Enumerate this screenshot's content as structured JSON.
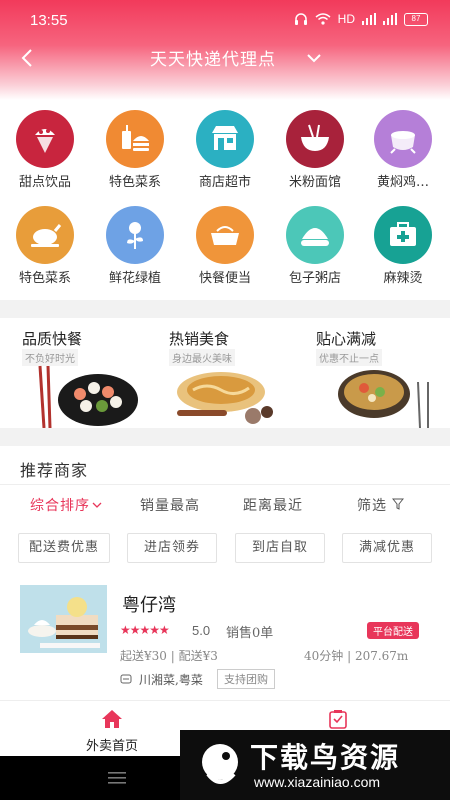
{
  "status_bar": {
    "time": "13:55",
    "network": "HD",
    "battery": "87"
  },
  "navbar": {
    "title": "天天快递代理点"
  },
  "categories": [
    {
      "label": "甜点饮品",
      "icon": "ice-cream-icon",
      "color": "#c8253e"
    },
    {
      "label": "特色菜系",
      "icon": "burger-drink-icon",
      "color": "#f08a33"
    },
    {
      "label": "商店超市",
      "icon": "store-icon",
      "color": "#2bb0c2"
    },
    {
      "label": "米粉面馆",
      "icon": "noodle-bowl-icon",
      "color": "#a8223b"
    },
    {
      "label": "黄焖鸡…",
      "icon": "pot-icon",
      "color": "#b57fd8"
    },
    {
      "label": "特色菜系",
      "icon": "roast-chicken-icon",
      "color": "#e89d3a"
    },
    {
      "label": "鲜花绿植",
      "icon": "flower-icon",
      "color": "#6ea2e5"
    },
    {
      "label": "快餐便当",
      "icon": "bento-icon",
      "color": "#f0953a"
    },
    {
      "label": "包子粥店",
      "icon": "bun-icon",
      "color": "#4cc7b8"
    },
    {
      "label": "麻辣烫",
      "icon": "medical-kit-icon",
      "color": "#17a294"
    }
  ],
  "promos": [
    {
      "title": "品质快餐",
      "subtitle": "不负好时光"
    },
    {
      "title": "热销美食",
      "subtitle": "身边最火美味"
    },
    {
      "title": "贴心满减",
      "subtitle": "优惠不止一点"
    }
  ],
  "recommend": {
    "title": "推荐商家",
    "sort_tabs": [
      "综合排序",
      "销量最高",
      "距离最近",
      "筛选"
    ],
    "filters": [
      "配送费优惠",
      "进店领券",
      "到店自取",
      "满减优惠"
    ]
  },
  "merchant": {
    "name": "粤仔湾",
    "stars": "★★★★★",
    "score": "5.0",
    "sales": "销售0单",
    "badge": "平台配送",
    "fee": "起送¥30 | 配送¥3",
    "distance": "40分钟 | 207.67m",
    "cuisine": "川湘菜,粤菜",
    "tag": "支持团购"
  },
  "bottom_nav": {
    "home": "外卖首页"
  },
  "watermark": {
    "text": "下载鸟资源",
    "url": "www.xiazainiao.com"
  },
  "colors": {
    "accent": "#e8365a",
    "header": "#f23a5b"
  }
}
